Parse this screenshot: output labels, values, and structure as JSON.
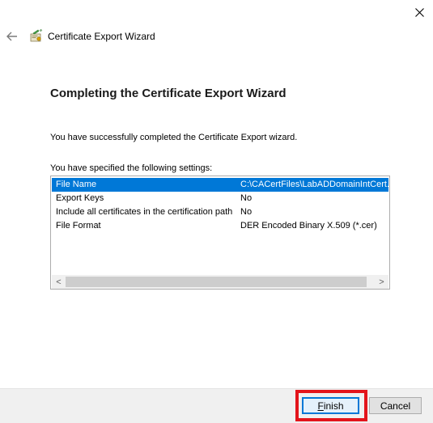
{
  "window": {
    "title": "Certificate Export Wizard",
    "icons": {
      "close": "close-icon",
      "back": "back-arrow-icon",
      "app": "certificate-wizard-icon"
    }
  },
  "main": {
    "heading": "Completing the Certificate Export Wizard",
    "success_text": "You have successfully completed the Certificate Export wizard.",
    "settings_label": "You have specified the following settings:"
  },
  "settings": [
    {
      "key": "File Name",
      "value": "C:\\CACertFiles\\LabADDomainIntCert.c",
      "selected": true
    },
    {
      "key": "Export Keys",
      "value": "No",
      "selected": false
    },
    {
      "key": "Include all certificates in the certification path",
      "value": "No",
      "selected": false
    },
    {
      "key": "File Format",
      "value": "DER Encoded Binary X.509 (*.cer)",
      "selected": false
    }
  ],
  "scrollbar": {
    "left_arrow": "<",
    "right_arrow": ">"
  },
  "footer": {
    "finish_accel": "F",
    "finish_rest": "inish",
    "cancel_label": "Cancel"
  },
  "colors": {
    "selection": "#0078d7",
    "highlight_box": "#e3141b",
    "footer_bg": "#f0f0f0"
  }
}
